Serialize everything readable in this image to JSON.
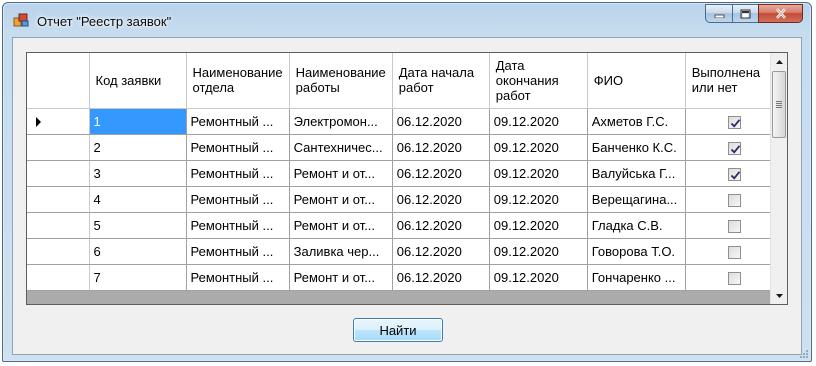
{
  "window": {
    "title": "Отчет \"Реестр заявок\""
  },
  "grid": {
    "columns": [
      "Код заявки",
      "Наименование отдела",
      "Наименование работы",
      "Дата начала работ",
      "Дата окончания работ",
      "ФИО",
      "Выполнена или нет"
    ],
    "rows": [
      {
        "code": "1",
        "dept": "Ремонтный ...",
        "work": "Электромон...",
        "start": "06.12.2020",
        "end": "09.12.2020",
        "fio": "Ахметов Г.С.",
        "done": true
      },
      {
        "code": "2",
        "dept": "Ремонтный ...",
        "work": "Сантехничес...",
        "start": "06.12.2020",
        "end": "09.12.2020",
        "fio": "Банченко К.С.",
        "done": true
      },
      {
        "code": "3",
        "dept": "Ремонтный ...",
        "work": "Ремонт и от...",
        "start": "06.12.2020",
        "end": "09.12.2020",
        "fio": "Валуйська Г...",
        "done": true
      },
      {
        "code": "4",
        "dept": "Ремонтный ...",
        "work": "Ремонт и от...",
        "start": "06.12.2020",
        "end": "09.12.2020",
        "fio": "Верещагина...",
        "done": false
      },
      {
        "code": "5",
        "dept": "Ремонтный ...",
        "work": "Ремонт и от...",
        "start": "06.12.2020",
        "end": "09.12.2020",
        "fio": "Гладка С.В.",
        "done": false
      },
      {
        "code": "6",
        "dept": "Ремонтный ...",
        "work": "Заливка чер...",
        "start": "06.12.2020",
        "end": "09.12.2020",
        "fio": "Говорова Т.О.",
        "done": false
      },
      {
        "code": "7",
        "dept": "Ремонтный ...",
        "work": "Ремонт и от...",
        "start": "06.12.2020",
        "end": "09.12.2020",
        "fio": "Гончаренко ...",
        "done": false
      }
    ],
    "selected_row": 0
  },
  "buttons": {
    "find": "Найти"
  },
  "colors": {
    "selection": "#3399ff",
    "grid_background": "#ababab",
    "close_button": "#c24a35"
  }
}
